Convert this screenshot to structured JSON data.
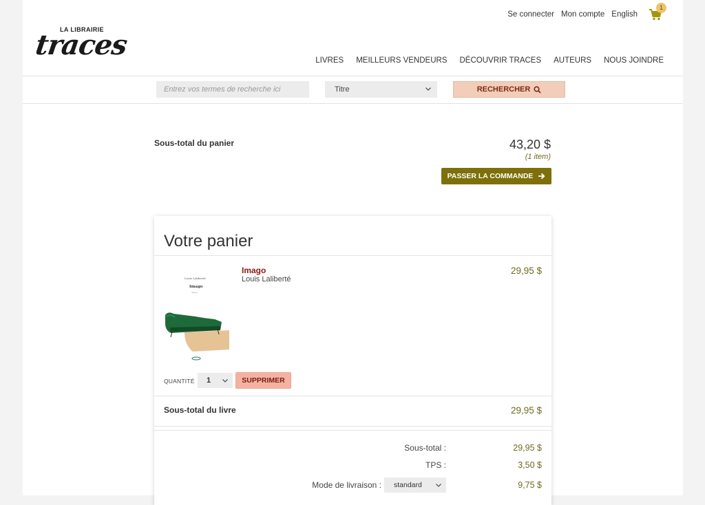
{
  "header": {
    "top_links": {
      "login": "Se connecter",
      "account": "Mon compte",
      "language": "English"
    },
    "cart_count": "1",
    "logo": {
      "small": "LA LIBRAIRIE",
      "big": "traces"
    },
    "nav": [
      "LIVRES",
      "MEILLEURS VENDEURS",
      "DÉCOUVRIR TRACES",
      "AUTEURS",
      "NOUS JOINDRE"
    ]
  },
  "search": {
    "placeholder": "Entrez vos termes de recherche ici",
    "filter_selected": "Titre",
    "button_label": "RECHERCHER"
  },
  "summary": {
    "label": "Sous-total du panier",
    "price": "43,20 $",
    "items": "(1 item)",
    "checkout_label": "PASSER LA COMMANDE"
  },
  "cart": {
    "title": "Votre panier",
    "item": {
      "title": "Imago",
      "author": "Louis Laliberté",
      "price": "29,95 $",
      "cover": {
        "author": "Louis Laliberté",
        "title": "Imago",
        "sub": "roman"
      },
      "quantity_label": "QUANTITÉ",
      "quantity": "1",
      "delete_label": "SUPPRIMER"
    },
    "book_subtotal_label": "Sous-total du livre",
    "book_subtotal": "29,95 $",
    "totals": {
      "subtotal_label": "Sous-total :",
      "subtotal": "29,95 $",
      "tps_label": "TPS :",
      "tps": "3,50 $",
      "shipping_label": "Mode de livraison :",
      "shipping_mode": "standard",
      "shipping": "9,75 $"
    }
  },
  "colors": {
    "accent_olive": "#7d6f09",
    "price_olive": "#6e6a1e",
    "book_title": "#8a1a10",
    "delete_bg": "#f4b2a3",
    "search_btn_bg": "#f2cdb9"
  }
}
